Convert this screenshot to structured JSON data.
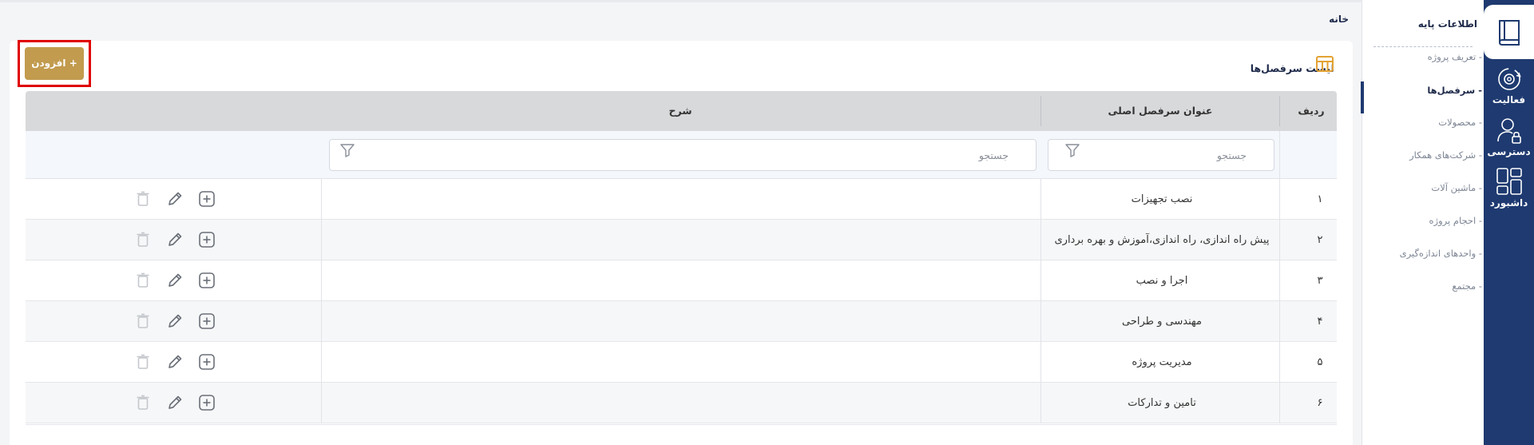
{
  "breadcrumb": "خانه",
  "rail": [
    {
      "label": "",
      "icon": "book-icon",
      "active": true
    },
    {
      "label": "فعالیت",
      "icon": "gear-cycle-icon"
    },
    {
      "label": "دسترسی",
      "icon": "user-lock-icon"
    },
    {
      "label": "داشبورد",
      "icon": "dashboard-grid-icon"
    }
  ],
  "sidebar": {
    "title": "اطلاعات پایه",
    "items": [
      {
        "label": "تعریف پروژه"
      },
      {
        "label": "سرفصل‌ها",
        "active": true
      },
      {
        "label": "محصولات"
      },
      {
        "label": "شرکت‌های همکار"
      },
      {
        "label": "ماشین آلات"
      },
      {
        "label": "احجام پروژه"
      },
      {
        "label": "واحدهای اندازه‌گیری"
      },
      {
        "label": "مجتمع"
      }
    ]
  },
  "toolbar": {
    "add_label": "+ افزودن",
    "list_title": "لیست سرفصل‌ها"
  },
  "table": {
    "headers": {
      "row": "ردیف",
      "title": "عنوان سرفصل اصلی",
      "description": "شرح"
    },
    "filters": {
      "title_placeholder": "جستجو",
      "description_placeholder": "جستجو"
    },
    "rows": [
      {
        "num": "۱",
        "title": "نصب تجهیزات",
        "description": ""
      },
      {
        "num": "۲",
        "title": "پیش راه اندازی، راه اندازی،آموزش و بهره برداری",
        "description": ""
      },
      {
        "num": "۳",
        "title": "اجرا و نصب",
        "description": ""
      },
      {
        "num": "۴",
        "title": "مهندسی و طراحی",
        "description": ""
      },
      {
        "num": "۵",
        "title": "مدیریت پروژه",
        "description": ""
      },
      {
        "num": "۶",
        "title": "تامین و تدارکات",
        "description": ""
      }
    ]
  },
  "colors": {
    "primary": "#1e3a70",
    "accent": "#c29b4e",
    "highlight": "#e00000"
  }
}
